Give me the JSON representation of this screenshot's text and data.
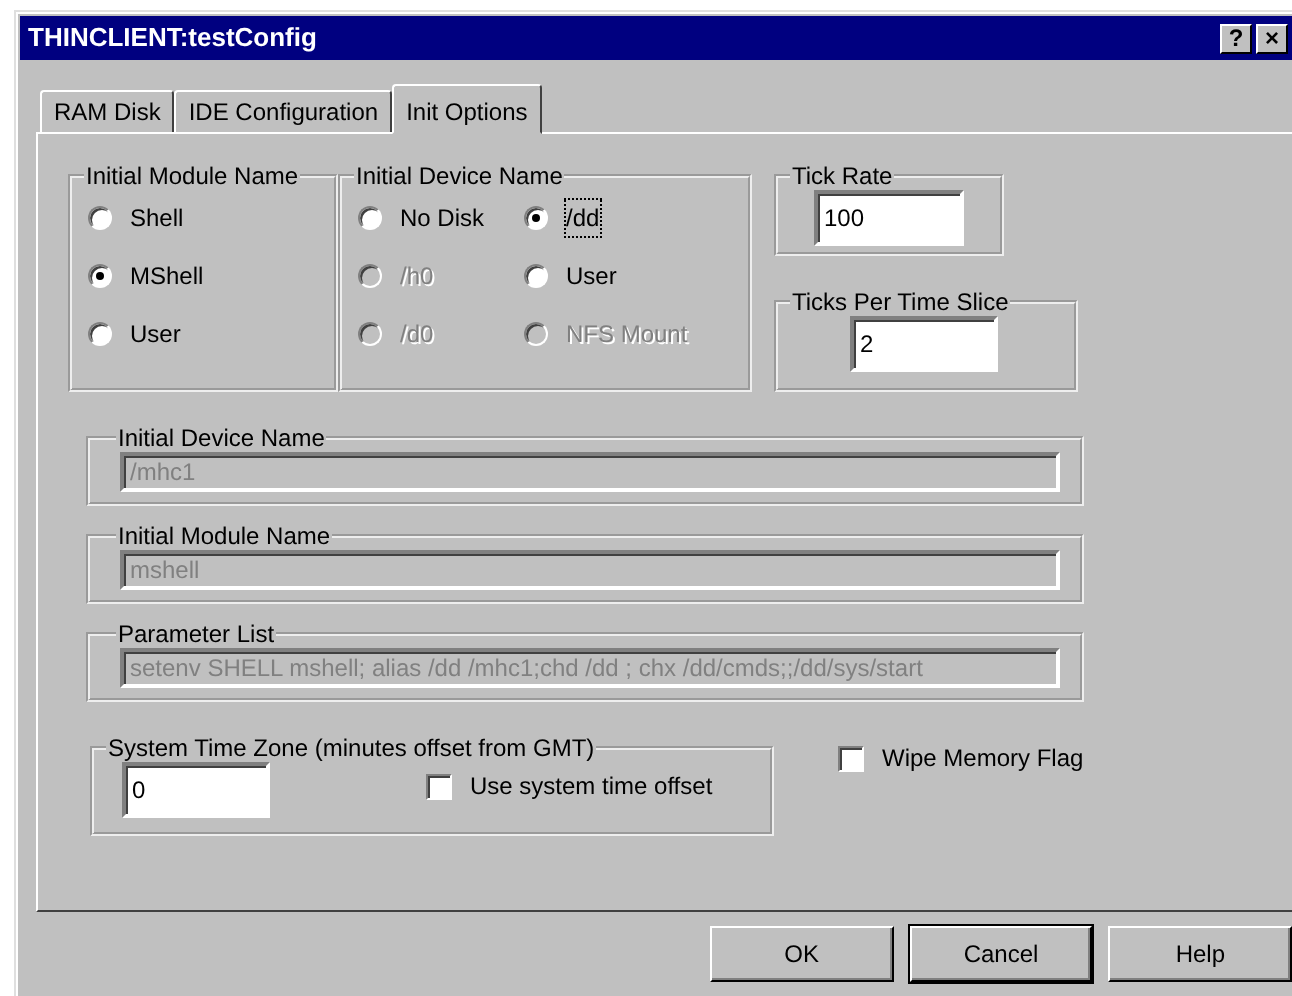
{
  "window": {
    "title": "THINCLIENT:testConfig",
    "title_buttons": [
      "?",
      "×"
    ]
  },
  "tabs": [
    {
      "label": "RAM Disk",
      "selected": false
    },
    {
      "label": "IDE Configuration",
      "selected": false
    },
    {
      "label": "Init Options",
      "selected": true
    }
  ],
  "module_group": {
    "legend": "Initial Module Name",
    "options": [
      {
        "label": "Shell",
        "selected": false,
        "disabled": false
      },
      {
        "label": "MShell",
        "selected": true,
        "disabled": false
      },
      {
        "label": "User",
        "selected": false,
        "disabled": false
      }
    ]
  },
  "device_group": {
    "legend": "Initial Device Name",
    "options": [
      {
        "label": "No Disk",
        "selected": false,
        "disabled": false,
        "focused": false
      },
      {
        "label": "/dd",
        "selected": true,
        "disabled": false,
        "focused": true
      },
      {
        "label": "/h0",
        "selected": false,
        "disabled": true,
        "focused": false
      },
      {
        "label": "User",
        "selected": false,
        "disabled": false,
        "focused": false
      },
      {
        "label": "/d0",
        "selected": false,
        "disabled": true,
        "focused": false
      },
      {
        "label": "NFS Mount",
        "selected": false,
        "disabled": true,
        "focused": false
      }
    ]
  },
  "tick_rate": {
    "legend": "Tick Rate",
    "value": "100"
  },
  "ticks_per_slice": {
    "legend": "Ticks Per Time Slice",
    "value": "2"
  },
  "text_fields": [
    {
      "legend": "Initial Device Name",
      "value": "/mhc1",
      "disabled": true
    },
    {
      "legend": "Initial Module Name",
      "value": "mshell",
      "disabled": true
    },
    {
      "legend": "Parameter List",
      "value": "setenv SHELL mshell; alias /dd /mhc1;chd /dd ; chx /dd/cmds;;/dd/sys/start",
      "disabled": true
    }
  ],
  "time_zone": {
    "legend": "System Time Zone (minutes offset from GMT)",
    "value": "0",
    "checkbox": {
      "label": "Use system time offset",
      "checked": false
    }
  },
  "wipe_memory": {
    "label": "Wipe Memory Flag",
    "checked": false
  },
  "buttons": [
    {
      "label": "OK",
      "default": false
    },
    {
      "label": "Cancel",
      "default": true
    },
    {
      "label": "Help",
      "default": false
    }
  ]
}
